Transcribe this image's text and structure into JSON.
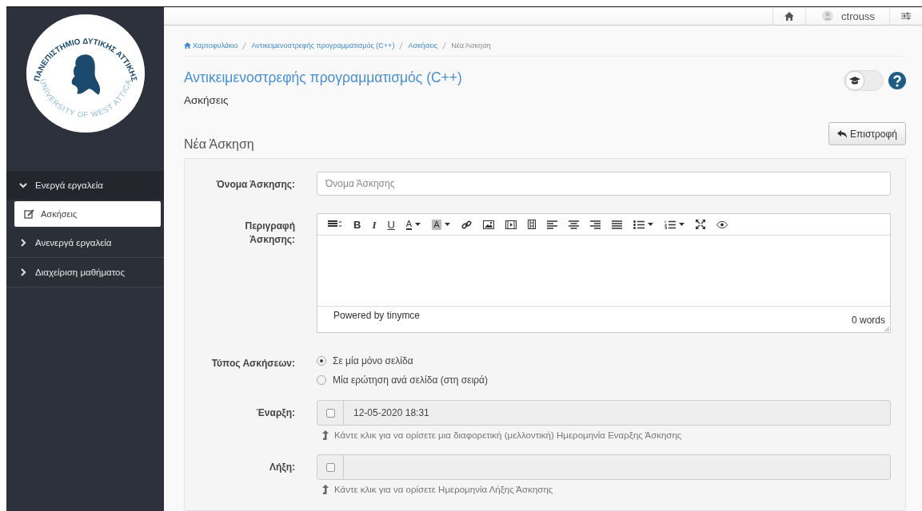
{
  "logo": {
    "top_text": "ΠΑΝΕΠΙΣΤΗΜΙΟ ΔΥΤΙΚΗΣ ΑΤΤΙΚΗΣ",
    "bottom_text": "UNIVERSITY OF WEST ATTICA"
  },
  "sidebar": {
    "sections": [
      {
        "label": "Ενεργά εργαλεία",
        "expanded": true,
        "children": [
          {
            "label": "Ασκήσεις",
            "selected": true
          }
        ]
      },
      {
        "label": "Ανενεργά εργαλεία",
        "expanded": false
      },
      {
        "label": "Διαχείριση μαθήματος",
        "expanded": false
      }
    ]
  },
  "top_bar": {
    "username": "ctrouss"
  },
  "breadcrumb": [
    {
      "label": "Χαρτοφυλάκιο",
      "kind": "home"
    },
    {
      "label": "Αντικειμενοστρεφής προγραμματισμός (C++)",
      "kind": "link"
    },
    {
      "label": "Ασκήσεις",
      "kind": "link"
    },
    {
      "label": "Νέα Άσκηση",
      "kind": "current"
    }
  ],
  "course_title": "Αντικειμενοστρεφής προγραμματισμός (C++)",
  "course_subtitle": "Ασκήσεις",
  "student_view_toggle": {
    "on": false
  },
  "page_heading": "Νέα Άσκηση",
  "back_button": "Επιστροφή",
  "form": {
    "name_label": "Όνομα Άσκησης:",
    "name_placeholder": "Όνομα Άσκησης",
    "description_label": "Περιγραφή Άσκησης:",
    "editor": {
      "toolbar": [
        {
          "kind": "paragraph"
        },
        {
          "kind": "bold",
          "label": "B"
        },
        {
          "kind": "italic",
          "label": "I"
        },
        {
          "kind": "underline",
          "label": "U"
        },
        {
          "kind": "forecolor",
          "label": "A"
        },
        {
          "kind": "backcolor",
          "label": "A"
        },
        {
          "kind": "link"
        },
        {
          "kind": "image"
        },
        {
          "kind": "media"
        },
        {
          "kind": "filmstrip"
        },
        {
          "kind": "align-left"
        },
        {
          "kind": "align-center"
        },
        {
          "kind": "align-right"
        },
        {
          "kind": "justify"
        },
        {
          "kind": "bullist"
        },
        {
          "kind": "numlist"
        },
        {
          "kind": "fullscreen"
        },
        {
          "kind": "preview"
        }
      ],
      "footer_text": "Powered by tinymce",
      "word_count": "0 words"
    },
    "type_label": "Τύπος Ασκήσεων:",
    "type_options": [
      {
        "label": "Σε μία μόνο σελίδα",
        "selected": true
      },
      {
        "label": "Μία ερώτηση ανά σελίδα (στη σειρά)",
        "selected": false
      }
    ],
    "dates": [
      {
        "label": "Έναρξη:",
        "checked": false,
        "value": "12-05-2020 18:31",
        "help": "Κάντε κλικ για να ορίσετε μια διαφορετική (μελλοντική) Ημερομηνία Εναρξης Άσκησης"
      },
      {
        "label": "Λήξη:",
        "checked": false,
        "help": "Κάντε κλικ για να ορίσετε Ημερομηνία Λήξης Άσκησης"
      }
    ]
  }
}
